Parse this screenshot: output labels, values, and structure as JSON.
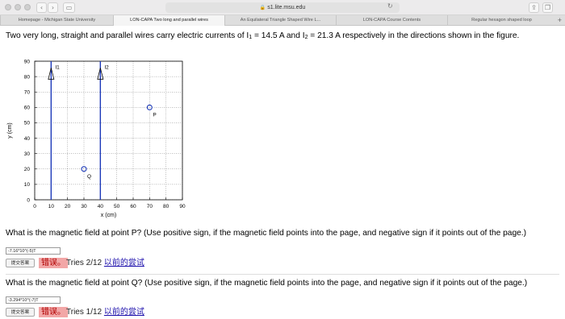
{
  "browser": {
    "url": "s1.lite.msu.edu",
    "tabs": [
      {
        "label": "Homepage - Michigan State University",
        "active": false
      },
      {
        "label": "LON-CAPA Two long and parallel wires",
        "active": true
      },
      {
        "label": "An Equilateral Triangle Shaped Wire L...",
        "active": false
      },
      {
        "label": "LON-CAPA Course Contents",
        "active": false
      },
      {
        "label": "Regular hexagon shaped loop",
        "active": false
      }
    ],
    "new_tab": "+"
  },
  "problem": {
    "statement_part1": "Two very long, straight and parallel wires carry electric currents of I",
    "i1_sub": "1",
    "eq1": " = 14.5 A and I",
    "i2_sub": "2",
    "eq2": " = 21.3 A respectively in the directions shown in the figure."
  },
  "chart_data": {
    "type": "scatter",
    "xlabel": "x (cm)",
    "ylabel": "y (cm)",
    "xlim": [
      0,
      90
    ],
    "ylim": [
      0,
      90
    ],
    "xticks": [
      0,
      10,
      20,
      30,
      40,
      50,
      60,
      70,
      80,
      90
    ],
    "yticks": [
      0,
      10,
      20,
      30,
      40,
      50,
      60,
      70,
      80,
      90
    ],
    "grid": true,
    "wires": [
      {
        "label": "I1",
        "x": 10,
        "arrow_y": 82,
        "direction": "up"
      },
      {
        "label": "I2",
        "x": 40,
        "arrow_y": 82,
        "direction": "up"
      }
    ],
    "points": [
      {
        "label": "P",
        "x": 70,
        "y": 60
      },
      {
        "label": "Q",
        "x": 30,
        "y": 20
      }
    ]
  },
  "questions": [
    {
      "text": "What is the magnetic field at point P? (Use positive sign, if the magnetic field points into the page, and negative sign if it points out of the page.)",
      "answer_value": "-7.16*10^(-5)T",
      "submit_label": "提交答案",
      "status_label": "错误。",
      "tries_text": "Tries 2/12",
      "prev_link": "以前的尝试"
    },
    {
      "text": "What is the magnetic field at point Q? (Use positive sign, if the magnetic field points into the page, and negative sign if it points out of the page.)",
      "answer_value": "-3.294*10^(-7)T",
      "submit_label": "提交答案",
      "status_label": "错误。",
      "tries_text": "Tries 1/12",
      "prev_link": "以前的尝试"
    }
  ]
}
